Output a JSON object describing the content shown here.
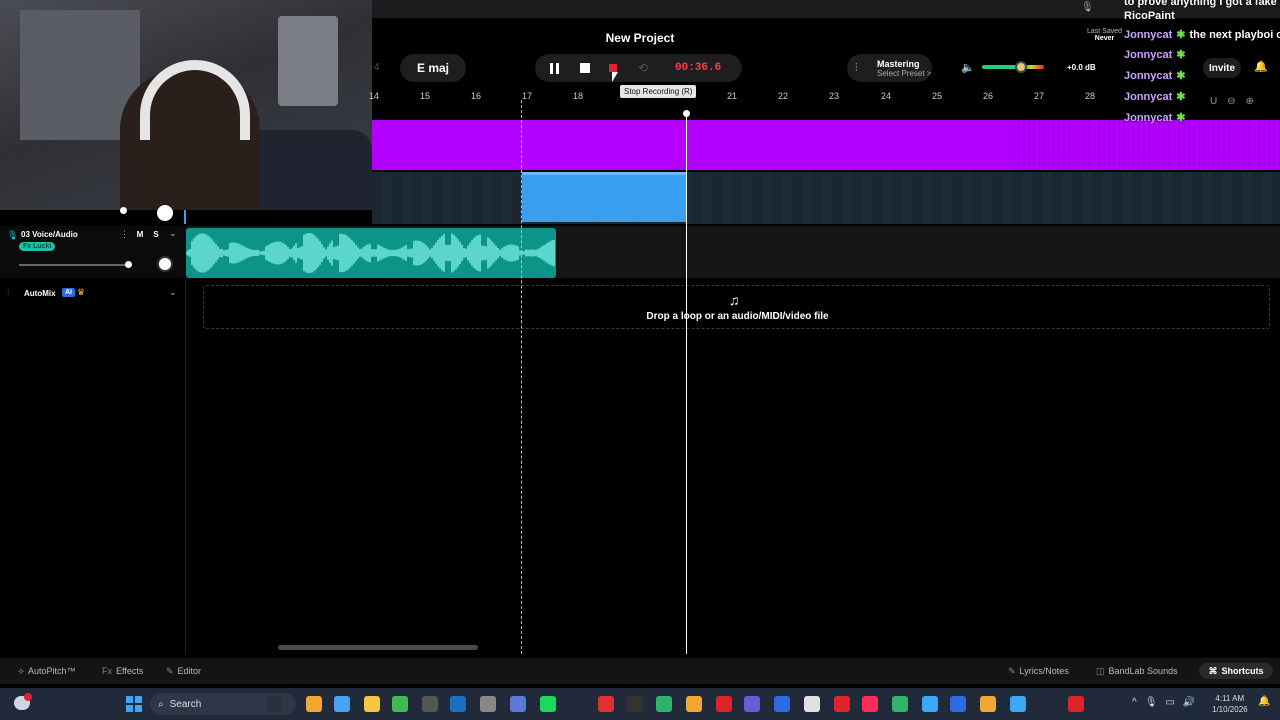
{
  "project": {
    "title": "New Project",
    "key": "E maj",
    "left_faded_number": "4",
    "timer": "00:36.6",
    "mastering_label": "Mastering",
    "mastering_preset": "Select Preset >",
    "volume_db": "+0.0 dB",
    "volume_level": 0.68,
    "last_saved_label": "Last Saved",
    "last_saved_value": "Never",
    "invite_label": "Invite",
    "tooltip": "Stop Recording (R)"
  },
  "ruler": {
    "ticks": [
      "14",
      "15",
      "16",
      "17",
      "18",
      "21",
      "22",
      "23",
      "24",
      "25",
      "26",
      "27",
      "28"
    ]
  },
  "tracks": {
    "voice": {
      "name": "03 Voice/Audio",
      "fx_badge": "Fx Lucki",
      "mute": "M",
      "solo": "S"
    },
    "automix": {
      "label": "AutoMix",
      "badge": "AI"
    }
  },
  "dropzone": {
    "text": "Drop a loop or an audio/MIDI/video file"
  },
  "bottombar": {
    "autopitch": "AutoPitch™",
    "effects": "Effects",
    "editor": "Editor",
    "lyrics": "Lyrics/Notes",
    "sounds": "BandLab Sounds",
    "shortcuts": "Shortcuts"
  },
  "taskbar": {
    "search": "Search",
    "time": "4:11 AM",
    "date": "1/10/2026"
  },
  "chat": {
    "lines": [
      {
        "user": "",
        "text": "to prove anything I got a fake p"
      },
      {
        "user": "",
        "text": "RicoPaint"
      },
      {
        "user": "Jonnycat",
        "text": "the next playboi ca"
      },
      {
        "user": "Jonnycat",
        "text": ""
      },
      {
        "user": "Jonnycat",
        "text": ""
      },
      {
        "user": "Jonnycat",
        "text": ""
      },
      {
        "user": "Jonnycat",
        "text": ""
      }
    ]
  },
  "colors": {
    "purple_track": "#b400ff",
    "blue_clip": "#3a9ff0",
    "teal_clip": "#0d9488",
    "record_red": "#e0242e",
    "timer_red": "#ff3b4a"
  },
  "icons": {
    "transport": [
      "pause-icon",
      "stop-icon",
      "record-icon",
      "loop-icon"
    ],
    "mastering": "sliders-icon",
    "volume": "speaker-icon",
    "notification": "bell-icon",
    "drop": "music-note-plus-icon"
  }
}
